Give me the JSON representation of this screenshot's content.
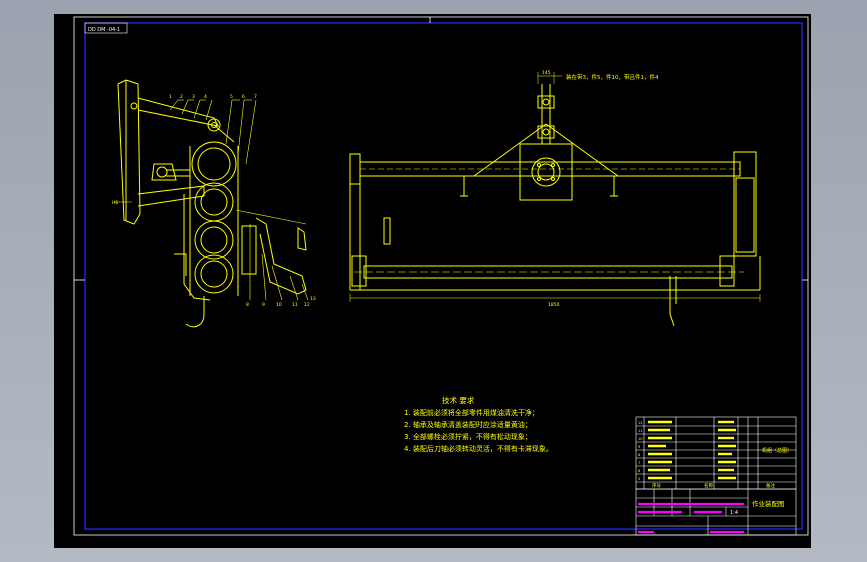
{
  "drawing": {
    "code_stamp": "DD DM -04-1",
    "top_note": "装在带3，件5，件10，带吕件1，件4",
    "dimension_top": "145",
    "dimension_bottom": "1850",
    "side_label_v": "H6",
    "leader_numbers_left": [
      "1",
      "2",
      "3",
      "4",
      "5",
      "6",
      "7"
    ],
    "leader_numbers_bottom": [
      "8",
      "9",
      "10",
      "11",
      "12",
      "13"
    ],
    "tech_requirements": {
      "title": "技术 要求",
      "items": [
        "1. 装配前必须将全部零件用煤油清洗干净；",
        "2. 轴承及轴承清盖装配时应涂适量黄油；",
        "3. 全部螺栓必须拧紧，不得有松动现象；",
        "4. 装配后刀轴必须转动灵活，不得有卡滞现象。"
      ]
    },
    "title_block": {
      "drawing_name": "作业装配图",
      "scale": "1:4",
      "material_note": "机组（总图）",
      "header_seq": "序号",
      "header_name": "名称",
      "header_remark": "备注"
    }
  },
  "colors": {
    "paper": "#000000",
    "line": "#ffff00",
    "frame": "#0000ff",
    "title_text": "#ff00ff",
    "border_white": "#ffffff"
  }
}
